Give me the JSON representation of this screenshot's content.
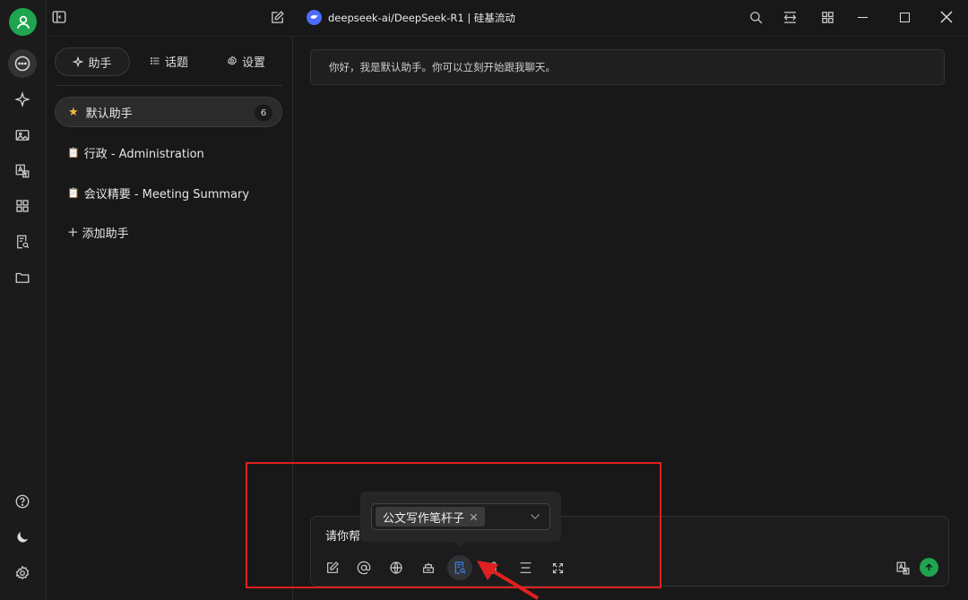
{
  "rail": {
    "top_items": [
      "chat-icon",
      "sparkle-icon",
      "image-icon",
      "translate-icon",
      "apps-icon",
      "knowledge-icon",
      "folder-icon"
    ],
    "bottom_items": [
      "help-icon",
      "moon-icon",
      "settings-icon"
    ]
  },
  "header": {
    "model_title": "deepseek-ai/DeepSeek-R1 | 硅基流动"
  },
  "sidebar": {
    "tabs": [
      {
        "label": "助手"
      },
      {
        "label": "话题"
      },
      {
        "label": "设置"
      }
    ],
    "assistants": [
      {
        "label": "默认助手",
        "count": "6"
      },
      {
        "label": "行政 - Administration"
      },
      {
        "label": "会议精要 - Meeting Summary"
      }
    ],
    "add_label": "添加助手"
  },
  "chat": {
    "greeting": "你好，我是默认助手。你可以立刻开始跟我聊天。"
  },
  "input": {
    "value": "请你帮",
    "knowledge_tag": "公文写作笔杆子"
  },
  "colors": {
    "accent": "#1fa44f",
    "highlight_box": "#e02020",
    "active_tool": "#3d7ddb"
  }
}
